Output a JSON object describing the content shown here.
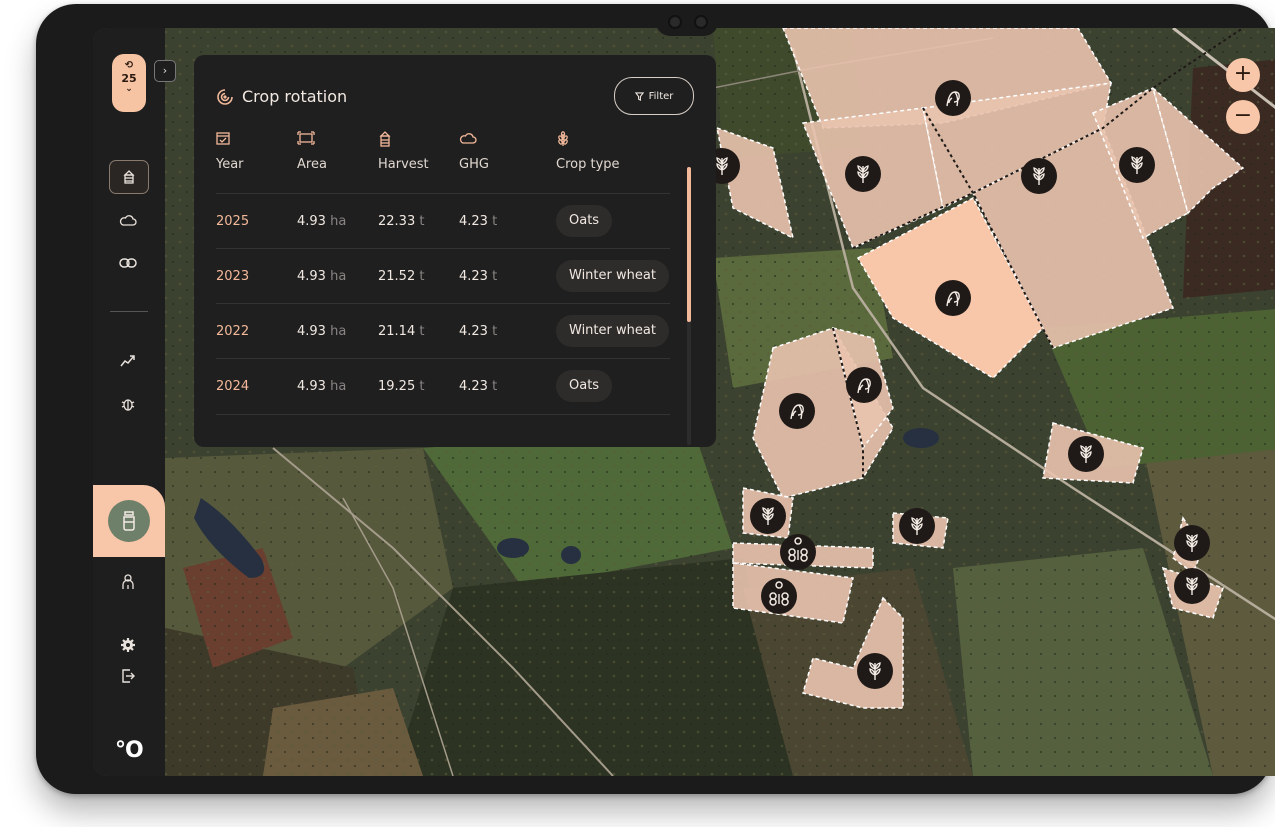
{
  "sidebar": {
    "year": "25",
    "history_icon": "history-icon",
    "chevron": "⌄",
    "expand_glyph": "›",
    "items": [
      {
        "name": "silo-icon",
        "active": true
      },
      {
        "name": "cloud-icon",
        "active": false
      },
      {
        "name": "link-icon",
        "active": false
      },
      {
        "name": "trend-icon",
        "active": false
      },
      {
        "name": "bug-icon",
        "active": false
      },
      {
        "name": "jar-icon",
        "active": true
      },
      {
        "name": "person-icon",
        "active": false
      },
      {
        "name": "gear-icon",
        "active": false
      },
      {
        "name": "logout-icon",
        "active": false
      }
    ],
    "logo": "°O"
  },
  "panel": {
    "title": "Crop rotation",
    "filter_label": "Filter",
    "columns": [
      "Year",
      "Area",
      "Harvest",
      "GHG",
      "Crop type"
    ],
    "rows": [
      {
        "year": "2025",
        "area": "4.93",
        "area_unit": "ha",
        "harvest": "22.33",
        "harvest_unit": "t",
        "ghg": "4.23",
        "ghg_unit": "t",
        "crop": "Oats"
      },
      {
        "year": "2023",
        "area": "4.93",
        "area_unit": "ha",
        "harvest": "21.52",
        "harvest_unit": "t",
        "ghg": "4.23",
        "ghg_unit": "t",
        "crop": "Winter wheat"
      },
      {
        "year": "2022",
        "area": "4.93",
        "area_unit": "ha",
        "harvest": "21.14",
        "harvest_unit": "t",
        "ghg": "4.23",
        "ghg_unit": "t",
        "crop": "Winter wheat"
      },
      {
        "year": "2024",
        "area": "4.93",
        "area_unit": "ha",
        "harvest": "19.25",
        "harvest_unit": "t",
        "ghg": "4.23",
        "ghg_unit": "t",
        "crop": "Oats"
      }
    ]
  },
  "map": {
    "zoom_in": "+",
    "zoom_out": "−",
    "colors": {
      "field": "#e9c3ae",
      "field_selected": "#f8c6a8",
      "marker": "#1f1a17",
      "panel": "#1f1f1f",
      "accent": "#f3b99a"
    }
  }
}
